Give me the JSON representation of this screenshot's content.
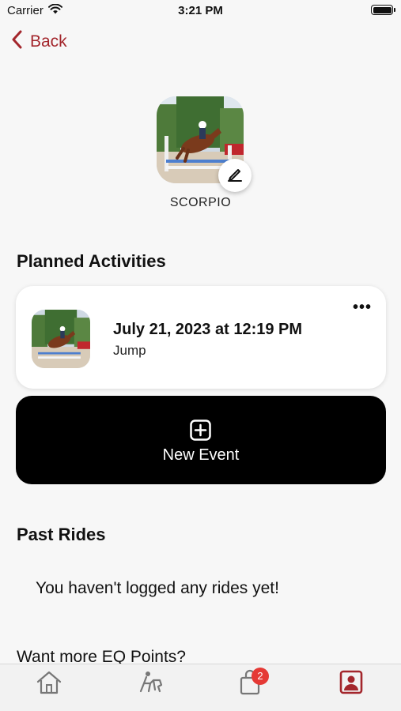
{
  "status_bar": {
    "carrier": "Carrier",
    "time": "3:21 PM"
  },
  "nav": {
    "back_label": "Back"
  },
  "horse": {
    "name": "SCORPIO"
  },
  "planned": {
    "title": "Planned Activities",
    "activities": [
      {
        "date": "July 21, 2023 at 12:19 PM",
        "type": "Jump",
        "more": "•••"
      }
    ],
    "new_event_label": "New Event"
  },
  "past_rides": {
    "title": "Past Rides",
    "empty_message": "You haven't logged any rides yet!"
  },
  "promo": {
    "title": "Want more EQ Points?"
  },
  "tab_bar": {
    "items": [
      {
        "icon": "home-icon"
      },
      {
        "icon": "rider-icon"
      },
      {
        "icon": "shopping-bag-icon",
        "badge": "2"
      },
      {
        "icon": "profile-icon"
      }
    ]
  },
  "colors": {
    "accent": "#a3262c",
    "badge": "#e53935",
    "button": "#000000"
  }
}
